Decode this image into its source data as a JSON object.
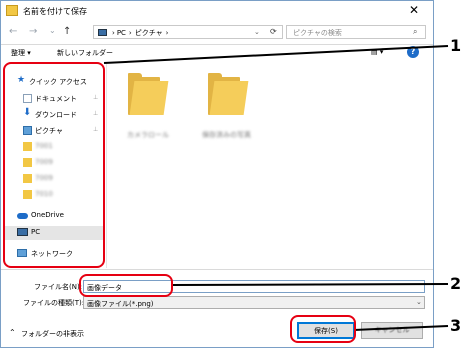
{
  "window": {
    "title": "名前を付けて保存",
    "close_glyph": "✕"
  },
  "nav": {
    "back_glyph": "←",
    "forward_glyph": "→",
    "recent_glyph": "⌄",
    "up_glyph": "↑",
    "address_parts": [
      "PC",
      "ピクチャ"
    ],
    "refresh_glyph": "⟳",
    "search_placeholder": "ピクチャの検索"
  },
  "toolbar": {
    "organize_label": "整理 ▾",
    "new_folder_label": "新しいフォルダー",
    "view_glyph": "▤ ▾",
    "help_glyph": "?"
  },
  "sidebar": {
    "quick_access_label": "クイック アクセス",
    "items": [
      {
        "label": "ドキュメント",
        "pinned": true
      },
      {
        "label": "ダウンロード",
        "pinned": true
      },
      {
        "label": "ピクチャ",
        "pinned": true
      },
      {
        "label": "7001"
      },
      {
        "label": "7009"
      },
      {
        "label": "7009"
      },
      {
        "label": "7010"
      }
    ],
    "onedrive_label": "OneDrive",
    "pc_label": "PC",
    "network_label": "ネットワーク",
    "pin_glyph": "📌"
  },
  "files": [
    {
      "name": "カメラロール"
    },
    {
      "name": "保存済みの写真"
    }
  ],
  "form": {
    "filename_label": "ファイル名(N):",
    "filename_value": "画像データ",
    "filetype_label": "ファイルの種類(T):",
    "filetype_value": "画像ファイル(*.png)"
  },
  "footer": {
    "hide_folders_label": "フォルダーの非表示",
    "save_label": "保存(S)",
    "cancel_label": "キャンセル"
  },
  "callouts": [
    "1",
    "2",
    "3"
  ],
  "colors": {
    "highlight": "#e60012",
    "folder": "#f5cd5a"
  }
}
